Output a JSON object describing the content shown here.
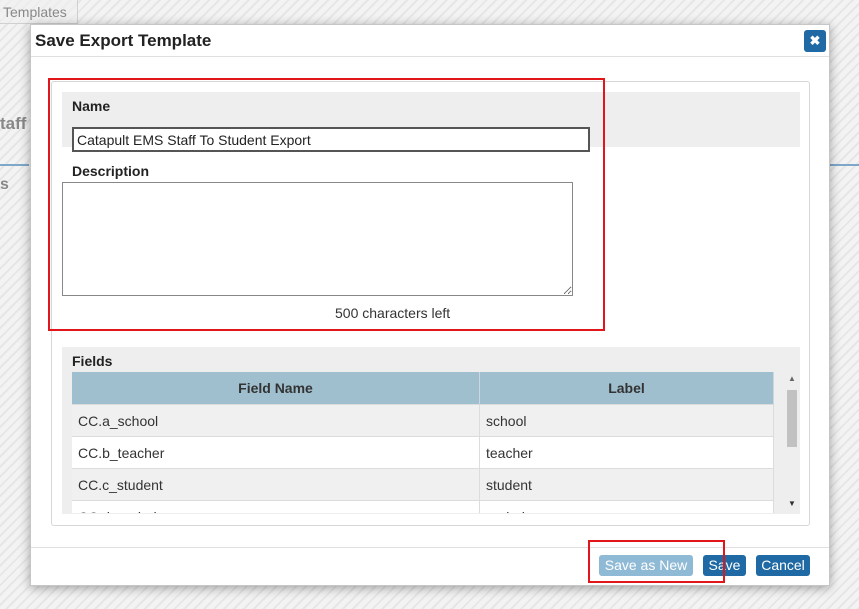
{
  "background": {
    "tab_label": "Templates",
    "side_fragment_1": "taff",
    "side_fragment_2": "s"
  },
  "dialog": {
    "title": "Save Export Template",
    "close_icon": "close-icon",
    "name_label": "Name",
    "name_value": "Catapult EMS Staff To Student Export",
    "description_label": "Description",
    "description_value": "",
    "chars_left": "500 characters left",
    "fields_label": "Fields",
    "fields_table": {
      "headers": [
        "Field Name",
        "Label"
      ],
      "rows": [
        {
          "field": "CC.a_school",
          "label": "school"
        },
        {
          "field": "CC.b_teacher",
          "label": "teacher"
        },
        {
          "field": "CC.c_student",
          "label": "student"
        },
        {
          "field": "CC.d_period",
          "label": "period"
        }
      ]
    },
    "buttons": {
      "save_as_new": "Save as New",
      "save": "Save",
      "cancel": "Cancel"
    }
  },
  "colors": {
    "primary_button": "#1f6aa5",
    "disabled_button": "#8fbad6",
    "table_header": "#9fbfcf",
    "highlight": "#e0161b"
  }
}
